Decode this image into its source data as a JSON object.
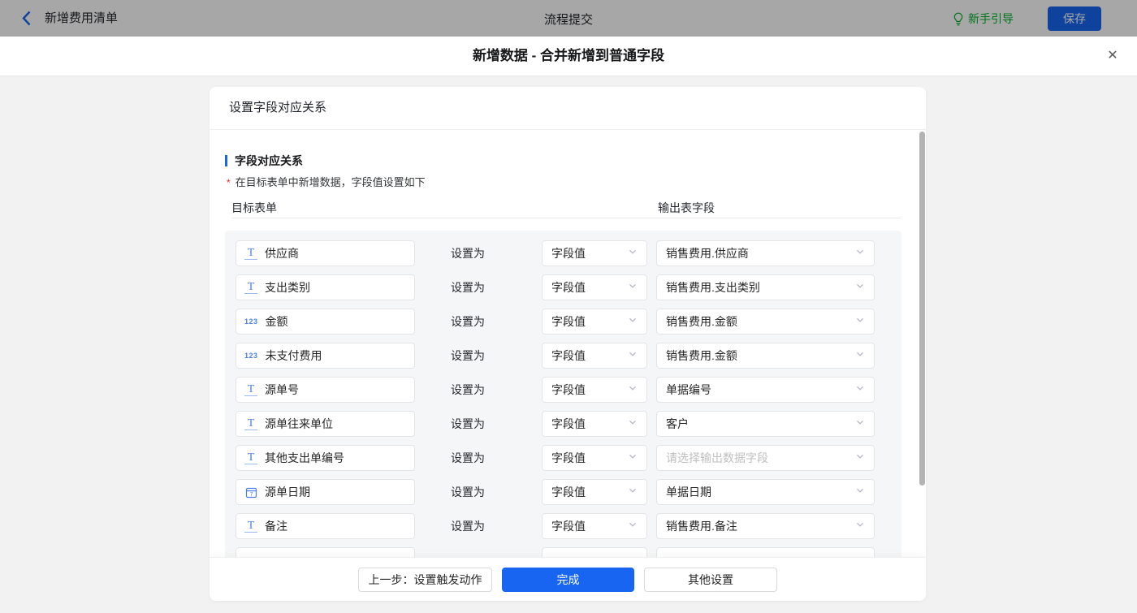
{
  "topbar": {
    "back_label": "新增费用清单",
    "center_title": "流程提交",
    "guide_label": "新手引导",
    "save_label": "保存"
  },
  "dialog": {
    "title": "新增数据 - 合并新增到普通字段",
    "close_glyph": "✕"
  },
  "card": {
    "header": "设置字段对应关系",
    "section_title": "字段对应关系",
    "required_mark": "*",
    "note": "在目标表单中新增数据，字段值设置如下",
    "col_left": "目标表单",
    "col_right": "输出表字段",
    "setas_label": "设置为",
    "rows": [
      {
        "icon": "text",
        "field": "供应商",
        "op": "字段值",
        "output": "销售费用.供应商",
        "is_placeholder": false,
        "partial": false
      },
      {
        "icon": "text",
        "field": "支出类别",
        "op": "字段值",
        "output": "销售费用.支出类别",
        "is_placeholder": false,
        "partial": false
      },
      {
        "icon": "number",
        "field": "金额",
        "op": "字段值",
        "output": "销售费用.金额",
        "is_placeholder": false,
        "partial": false
      },
      {
        "icon": "number",
        "field": "未支付费用",
        "op": "字段值",
        "output": "销售费用.金额",
        "is_placeholder": false,
        "partial": false
      },
      {
        "icon": "text",
        "field": "源单号",
        "op": "字段值",
        "output": "单据编号",
        "is_placeholder": false,
        "partial": false
      },
      {
        "icon": "text",
        "field": "源单往来单位",
        "op": "字段值",
        "output": "客户",
        "is_placeholder": false,
        "partial": false
      },
      {
        "icon": "text",
        "field": "其他支出单编号",
        "op": "字段值",
        "output": "请选择输出数据字段",
        "is_placeholder": true,
        "partial": false
      },
      {
        "icon": "date",
        "field": "源单日期",
        "op": "字段值",
        "output": "单据日期",
        "is_placeholder": false,
        "partial": false
      },
      {
        "icon": "text",
        "field": "备注",
        "op": "字段值",
        "output": "销售费用.备注",
        "is_placeholder": false,
        "partial": false
      },
      {
        "icon": "none",
        "field": "",
        "op": "",
        "output": "",
        "is_placeholder": false,
        "partial": true
      }
    ]
  },
  "footer": {
    "prev_label": "上一步：设置触发动作",
    "done_label": "完成",
    "other_label": "其他设置"
  },
  "icons": {
    "text_glyph": "T",
    "number_glyph": "123",
    "date_glyph": "7"
  },
  "colors": {
    "accent_blue": "#1765f0",
    "icon_blue": "#4d7fe8",
    "guide_green": "#00b32a",
    "required_red": "#f5222d"
  }
}
